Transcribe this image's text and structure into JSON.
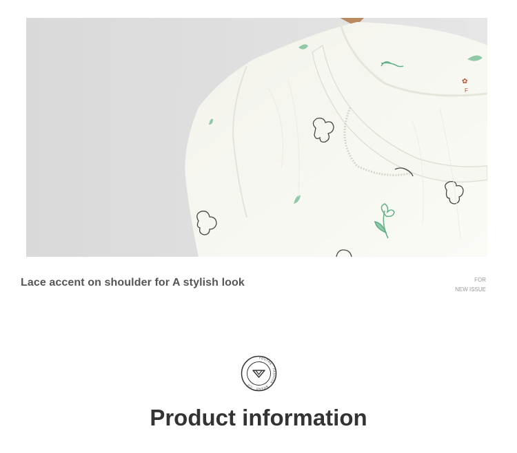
{
  "feature": {
    "photo_alt": "White blouse with lace collar and bunny print",
    "caption": "Lace accent on shoulder for A stylish look",
    "note_line1": "FOR",
    "note_line2": "NEW ISSUE"
  },
  "section": {
    "emblem_icon": "diamond-badge-icon",
    "emblem_text": "YOUTHS · FASHION · BRAND · CO.",
    "title": "Product information"
  },
  "colors": {
    "caption_text": "#555555",
    "title_text": "#333333",
    "note_text": "#9a9a9a",
    "print_green": "#5fae86"
  }
}
